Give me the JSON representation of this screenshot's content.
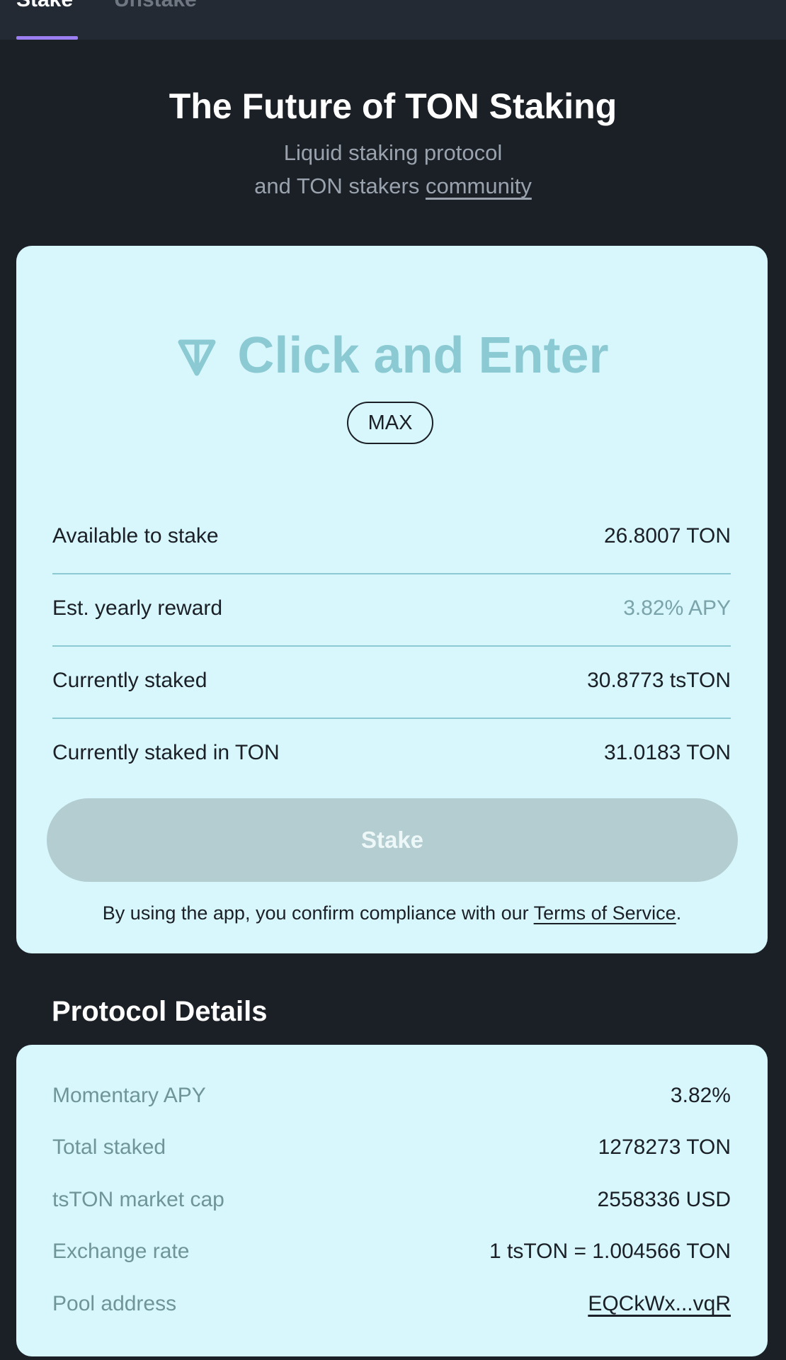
{
  "tabs": [
    {
      "label": "Stake",
      "active": true
    },
    {
      "label": "Unstake",
      "active": false
    }
  ],
  "hero": {
    "title": "The Future of TON Staking",
    "subtitle_line1": "Liquid staking protocol",
    "subtitle_line2_prefix": "and TON stakers ",
    "subtitle_link": "community"
  },
  "stake_card": {
    "amount_placeholder": "Click and Enter",
    "max_label": "MAX",
    "rows": [
      {
        "label": "Available to stake",
        "value": "26.8007 TON"
      },
      {
        "label": "Est. yearly reward",
        "value": "3.82% APY"
      },
      {
        "label": "Currently staked",
        "value": "30.8773 tsTON"
      },
      {
        "label": "Currently staked in TON",
        "value": "31.0183 TON"
      }
    ],
    "stake_button": "Stake",
    "tos_prefix": "By using the app, you confirm compliance with our ",
    "tos_link": "Terms of Service",
    "tos_suffix": "."
  },
  "protocol": {
    "title": "Protocol Details",
    "rows": [
      {
        "label": "Momentary APY",
        "value": "3.82%"
      },
      {
        "label": "Total staked",
        "value": "1278273 TON"
      },
      {
        "label": "tsTON market cap",
        "value": "2558336 USD"
      },
      {
        "label": "Exchange rate",
        "value": "1 tsTON = 1.004566 TON"
      },
      {
        "label": "Pool address",
        "value": "EQCkWx...vqR"
      }
    ]
  },
  "colors": {
    "background": "#1b1f26",
    "card": "#d7f7fc",
    "accent_underline": "#9b7ff2",
    "placeholder": "#8ccad3",
    "button_disabled": "#b3cdd1"
  },
  "icons": {
    "ton": "ton-icon"
  }
}
